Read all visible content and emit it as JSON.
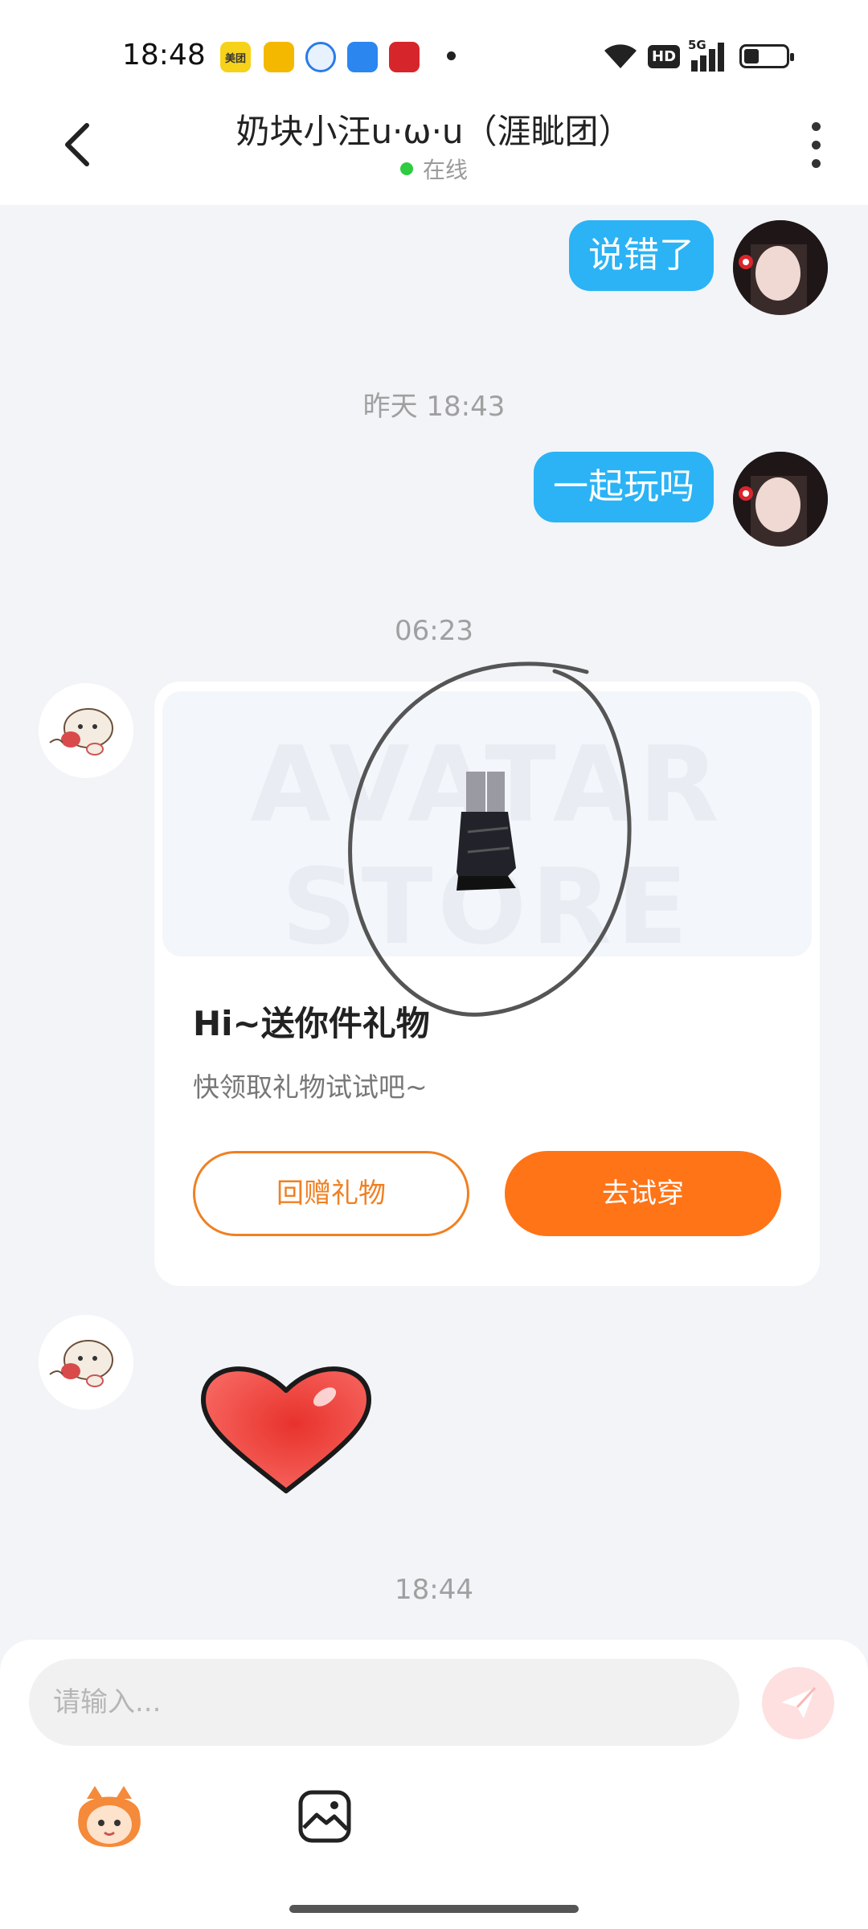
{
  "status_bar": {
    "time": "18:48",
    "apps": [
      "美团",
      "阅读",
      "浏览器",
      "应用",
      "银行"
    ],
    "hd": "HD",
    "network": "5G"
  },
  "header": {
    "title": "奶块小汪u·ω·u（涯眦团）",
    "online": "在线"
  },
  "messages": {
    "out_1": "说错了",
    "ts_1": "昨天 18:43",
    "out_2": "一起玩吗",
    "ts_2": "06:23",
    "ts_3": "18:44"
  },
  "gift_card": {
    "watermark": "AVATAR STORE",
    "title": "Hi~送你件礼物",
    "subtitle": "快领取礼物试试吧~",
    "return_gift": "回赠礼物",
    "try_on": "去试穿"
  },
  "input": {
    "placeholder": "请输入..."
  },
  "colors": {
    "accent": "#ff7417",
    "bubble": "#2bb3f5",
    "background": "#f2f4f7"
  }
}
